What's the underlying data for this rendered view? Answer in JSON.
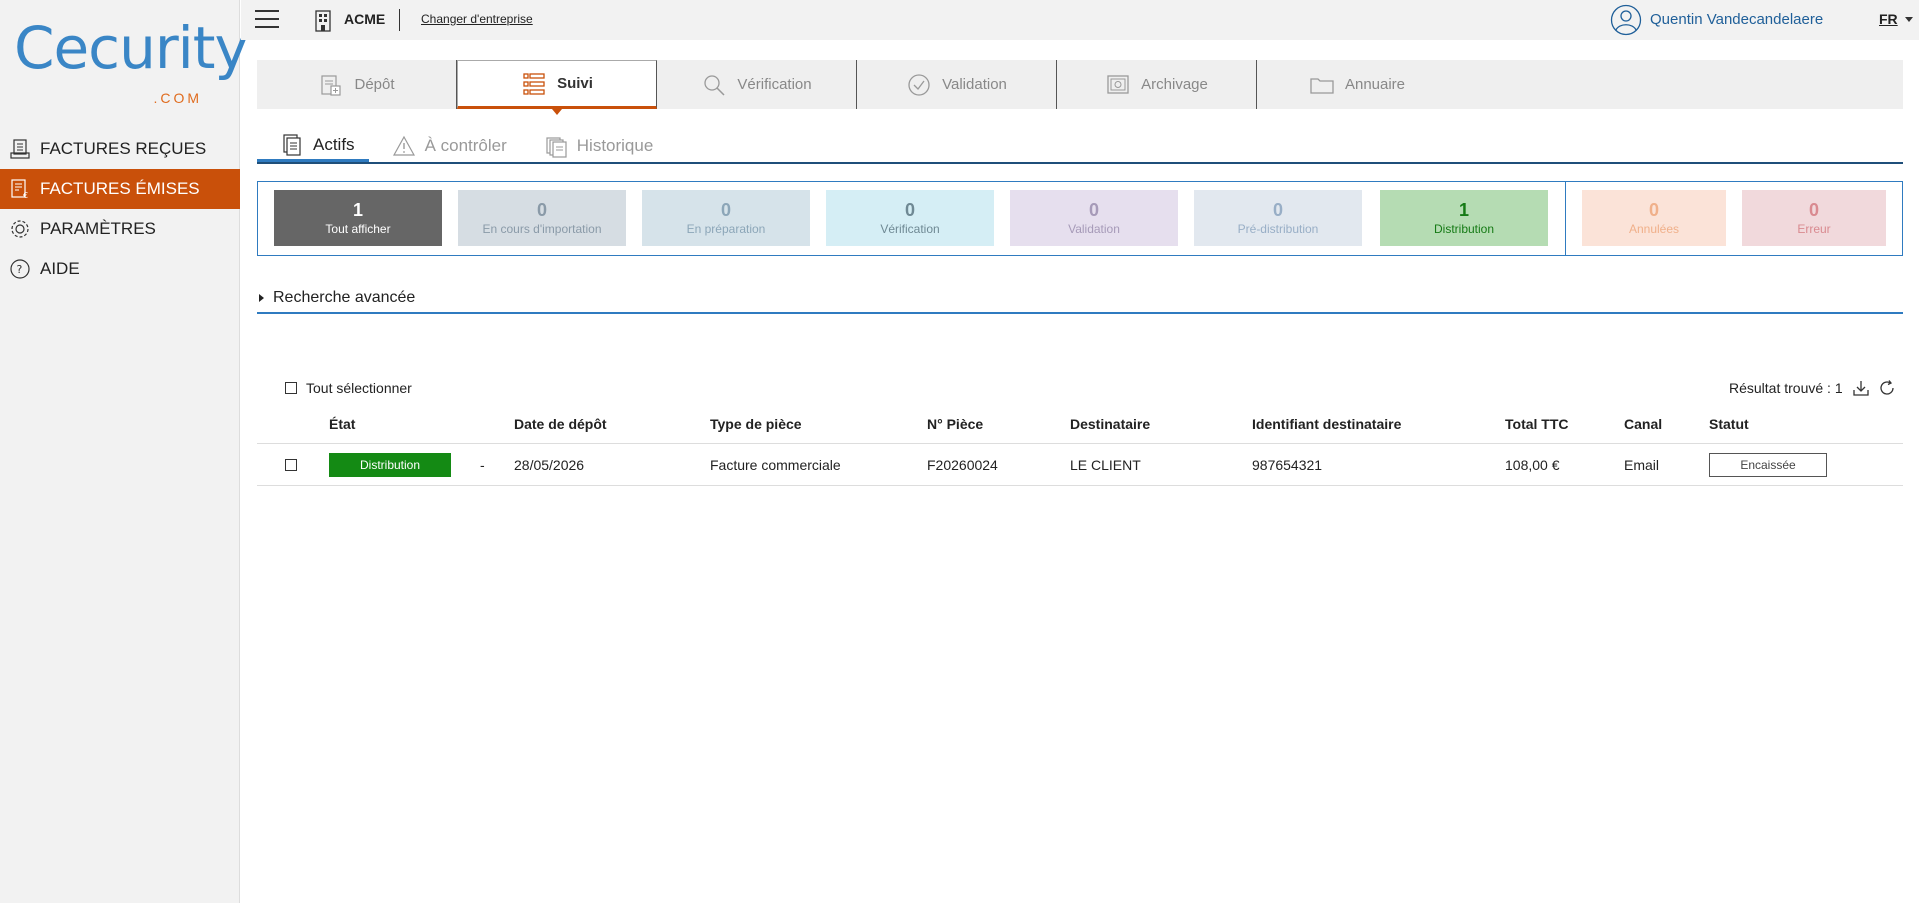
{
  "logo": {
    "text": "Cecurity",
    "sub": ".COM"
  },
  "sidebar": {
    "items": [
      {
        "label": "FACTURES REÇUES",
        "icon": "received-invoices-icon"
      },
      {
        "label": "FACTURES ÉMISES",
        "icon": "issued-invoices-icon",
        "active": true
      },
      {
        "label": "PARAMÈTRES",
        "icon": "gear-icon"
      },
      {
        "label": "AIDE",
        "icon": "help-icon"
      }
    ]
  },
  "topbar": {
    "company": "ACME",
    "change_company": "Changer d'entreprise",
    "user": "Quentin Vandecandelaere",
    "lang": "FR"
  },
  "main_tabs": [
    {
      "label": "Dépôt",
      "icon": "deposit-icon"
    },
    {
      "label": "Suivi",
      "icon": "list-icon",
      "active": true
    },
    {
      "label": "Vérification",
      "icon": "magnifier-icon"
    },
    {
      "label": "Validation",
      "icon": "check-circle-icon"
    },
    {
      "label": "Archivage",
      "icon": "safe-icon"
    },
    {
      "label": "Annuaire",
      "icon": "folder-icon"
    }
  ],
  "sub_tabs": [
    {
      "label": "Actifs",
      "icon": "documents-icon",
      "active": true
    },
    {
      "label": "À contrôler",
      "icon": "warning-icon"
    },
    {
      "label": "Historique",
      "icon": "history-icon"
    }
  ],
  "counters": [
    {
      "count": "1",
      "label": "Tout afficher",
      "bg": "#666666",
      "color": "#ffffff"
    },
    {
      "count": "0",
      "label": "En cours d'importation",
      "bg": "#d6dde3",
      "color": "#8a9aa8"
    },
    {
      "count": "0",
      "label": "En préparation",
      "bg": "#d6e3ea",
      "color": "#8ca6b8"
    },
    {
      "count": "0",
      "label": "Vérification",
      "bg": "#d5eef5",
      "color": "#6f8994"
    },
    {
      "count": "0",
      "label": "Validation",
      "bg": "#e6dfee",
      "color": "#a69ab8"
    },
    {
      "count": "0",
      "label": "Pré-distribution",
      "bg": "#e2e8ef",
      "color": "#98aec6"
    },
    {
      "count": "1",
      "label": "Distribution",
      "bg": "#b5dcb3",
      "color": "#157a15"
    },
    {
      "count": "0",
      "label": "Annulées",
      "bg": "#fbe3d8",
      "color": "#f0b08a"
    },
    {
      "count": "0",
      "label": "Erreur",
      "bg": "#f1d9dc",
      "color": "#d98a90"
    }
  ],
  "advanced_search": "Recherche avancée",
  "table": {
    "select_all": "Tout sélectionner",
    "result_count": "Résultat trouvé : 1",
    "headers": {
      "etat": "État",
      "date": "Date de dépôt",
      "type": "Type de pièce",
      "num": "N° Pièce",
      "dest": "Destinataire",
      "dest_id": "Identifiant destinataire",
      "total": "Total TTC",
      "canal": "Canal",
      "statut": "Statut"
    },
    "rows": [
      {
        "etat": "Distribution",
        "dash": "-",
        "date": "28/05/2026",
        "type": "Facture commerciale",
        "num": "F20260024",
        "dest": "LE CLIENT",
        "dest_id": "987654321",
        "total": "108,00 €",
        "canal": "Email",
        "statut": "Encaissée"
      }
    ]
  }
}
